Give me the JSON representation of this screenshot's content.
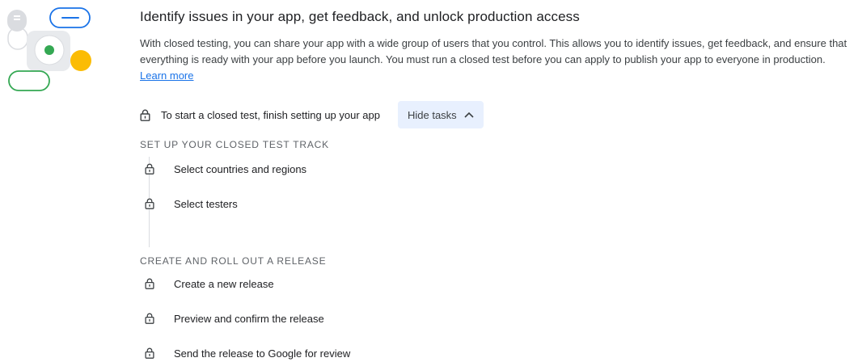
{
  "header": {
    "title": "Identify issues in your app, get feedback, and unlock production access",
    "description": "With closed testing, you can share your app with a wide group of users that you control. This allows you to identify issues, get feedback, and ensure that everything is ready with your app before you launch. You must run a closed test before you can apply to publish your app to everyone in production.",
    "learn_more": "Learn more"
  },
  "start": {
    "text": "To start a closed test, finish setting up your app",
    "hide_tasks": "Hide tasks"
  },
  "sections": [
    {
      "heading": "SET UP YOUR CLOSED TEST TRACK",
      "tasks": [
        "Select countries and regions",
        "Select testers"
      ]
    },
    {
      "heading": "CREATE AND ROLL OUT A RELEASE",
      "tasks": [
        "Create a new release",
        "Preview and confirm the release",
        "Send the release to Google for review"
      ]
    }
  ],
  "icons": {
    "lock": "lock-icon",
    "chevron": "chevron-up-icon",
    "illustration": "closed-testing-illustration"
  },
  "colors": {
    "accent_blue": "#1a73e8",
    "button_bg": "#e8f0fe",
    "green": "#34a853",
    "yellow": "#fbbc04",
    "grey": "#dadce0"
  }
}
